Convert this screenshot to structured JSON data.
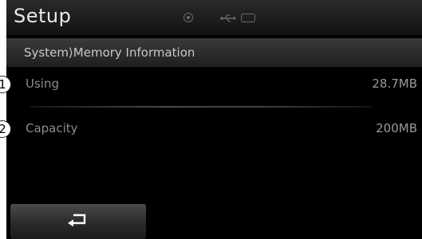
{
  "header": {
    "title": "Setup",
    "status_icons": [
      "disc-icon",
      "usb-icon",
      "battery-icon"
    ]
  },
  "breadcrumb": {
    "text": "System⟩Memory Information"
  },
  "rows": [
    {
      "callout": "1",
      "label": "Using",
      "value": "28.7MB"
    },
    {
      "callout": "2",
      "label": "Capacity",
      "value": "200MB"
    }
  ],
  "footer": {
    "back_icon": "back-arrow-icon"
  }
}
